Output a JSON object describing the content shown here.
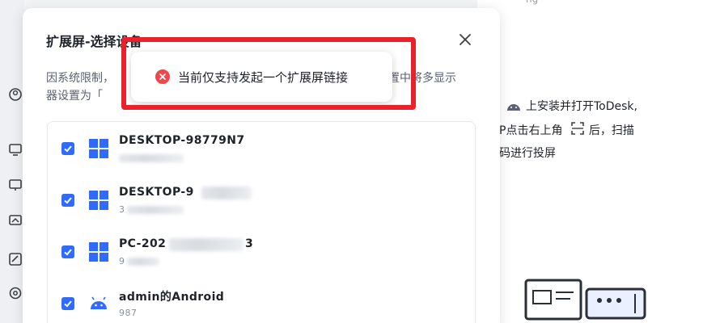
{
  "dialog": {
    "title": "扩展屏-选择设备",
    "description_line1": "因系统限制，",
    "description_line1_end": "置中将多显示",
    "description_line2": "器设置为「",
    "close_icon": "close-icon"
  },
  "toast": {
    "message": "当前仅支持发起一个扩展屏链接",
    "icon": "error-circle-icon",
    "icon_color": "#f0474a"
  },
  "devices": [
    {
      "name": "DESKTOP-",
      "name_partial": "DESKTOP-98779N7",
      "id": "",
      "icon": "windows-icon",
      "checked": true
    },
    {
      "name": "DESKTOP-9",
      "id": "3",
      "icon": "windows-icon",
      "checked": true
    },
    {
      "name": "PC-202",
      "name_suffix": "3",
      "id": "9",
      "icon": "windows-icon",
      "checked": true
    },
    {
      "name": "admin的Android",
      "id": "987",
      "icon": "android-icon",
      "checked": true
    }
  ],
  "background": {
    "top_text": "ng",
    "line1": "上安装并打开ToDesk,",
    "line2_prefix": "P点击右上角",
    "line2_suffix": "后，扫描",
    "line3": "码进行投屏"
  },
  "colors": {
    "accent": "#2f6bff",
    "highlight": "#e8212c",
    "windows": "#2f6bff"
  }
}
